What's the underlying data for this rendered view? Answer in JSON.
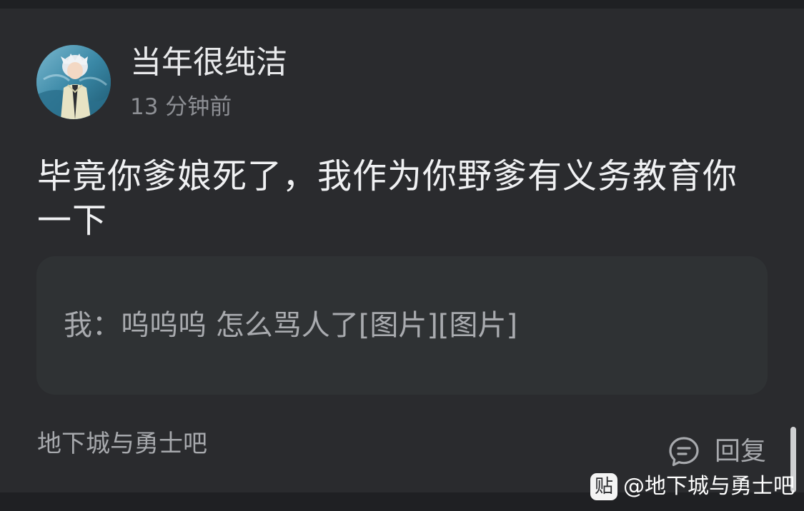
{
  "post": {
    "author": "当年很纯洁",
    "time": "13 分钟前",
    "content": "毕竟你爹娘死了，我作为你野爹有义务教育你一下",
    "quote": "我：呜呜呜 怎么骂人了[图片][图片]",
    "forum": "地下城与勇士吧",
    "reply_label": "回复"
  },
  "watermark": {
    "badge": "贴",
    "text": "@地下城与勇士吧"
  },
  "colors": {
    "background": "#2a2b2e",
    "quote_box": "#2f3234",
    "primary_text": "#f0f1f3",
    "secondary_text": "#a7a9ad"
  },
  "icons": {
    "reply": "comment-bubble-icon",
    "avatar": "anime-character-avatar"
  }
}
